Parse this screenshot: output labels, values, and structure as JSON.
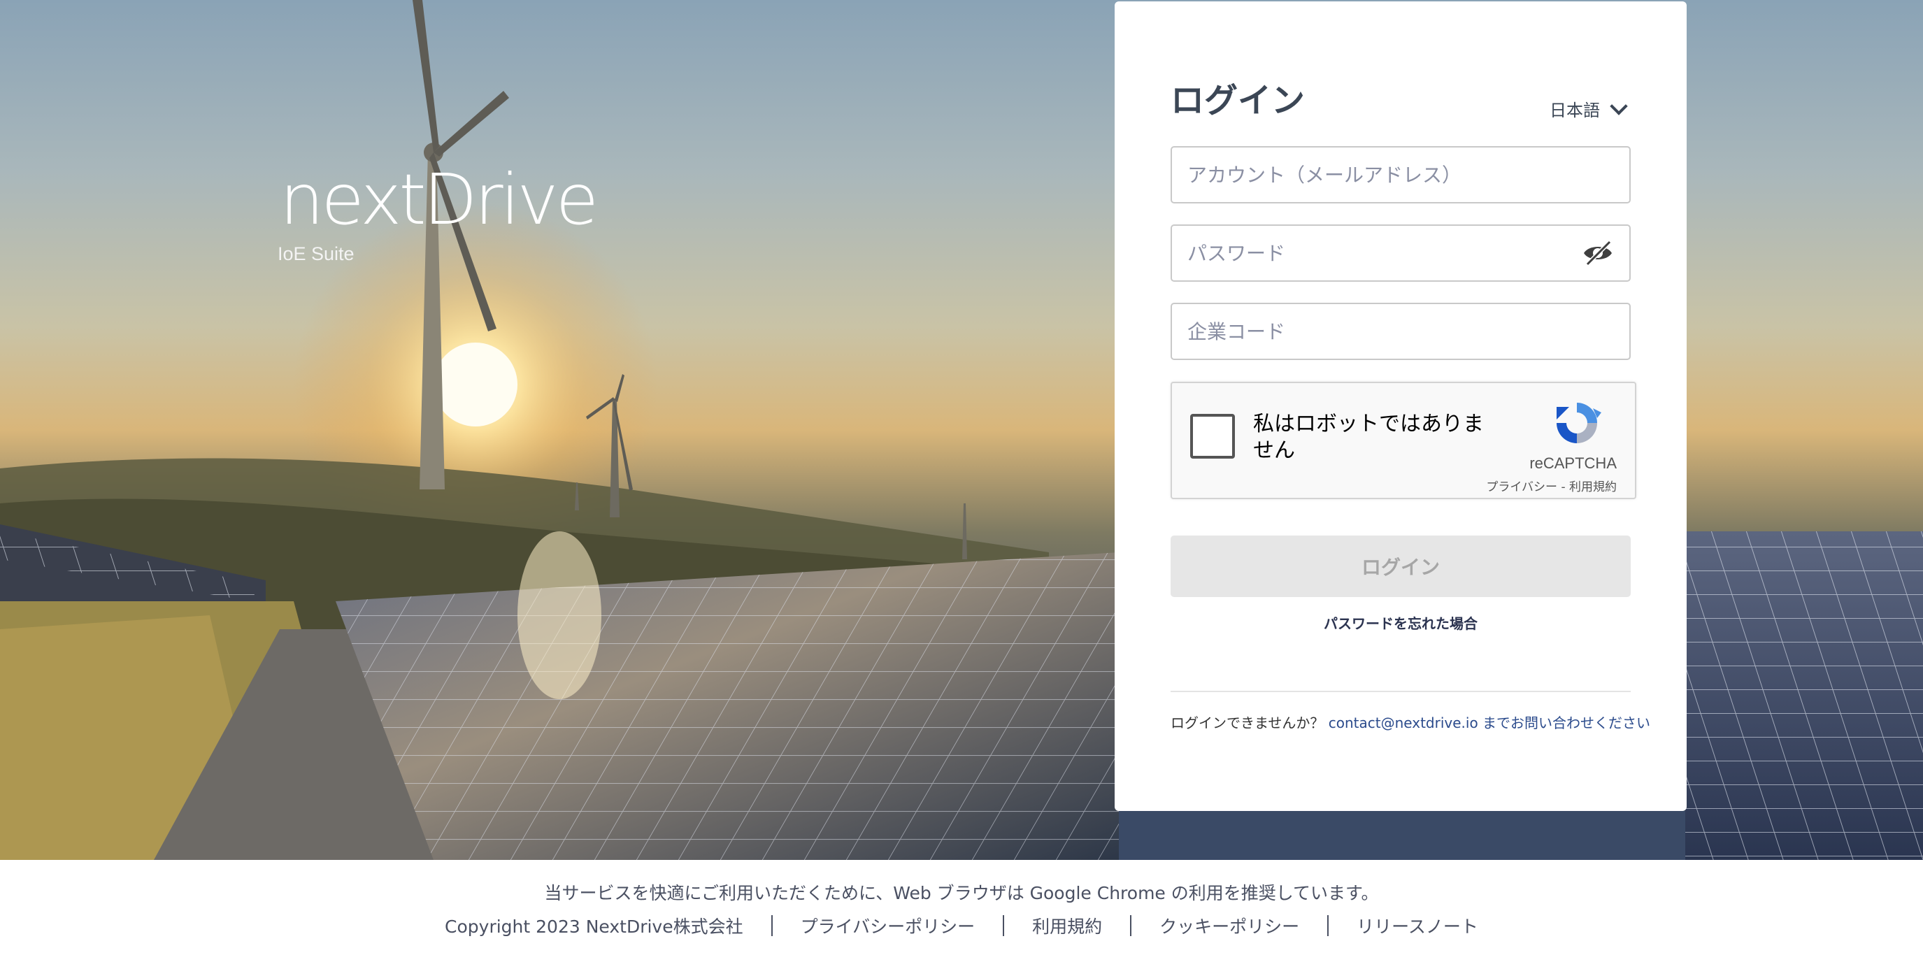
{
  "brand": {
    "logo_word": "nextDrive",
    "logo_sub": "IoE Suite"
  },
  "login": {
    "title": "ログイン",
    "language": "日本語",
    "account_placeholder": "アカウント（メールアドレス）",
    "password_placeholder": "パスワード",
    "company_placeholder": "企業コード",
    "recaptcha": {
      "label": "私はロボットではありません",
      "brand": "reCAPTCHA",
      "terms": "プライバシー - 利用規約"
    },
    "submit_label": "ログイン",
    "forgot_password": "パスワードを忘れた場合",
    "help": {
      "prefix": "ログインできませんか？",
      "email": "contact@nextdrive.io",
      "suffix": "までお問い合わせください"
    }
  },
  "footer": {
    "browser_note": "当サービスを快適にご利用いただくために、Web ブラウザは Google Chrome の利用を推奨しています。",
    "links": [
      "Copyright 2023 NextDrive株式会社",
      "プライバシーポリシー",
      "利用規約",
      "クッキーポリシー",
      "リリースノート"
    ]
  },
  "colors": {
    "title": "#3b4655",
    "button_disabled_bg": "#e6e6e6",
    "button_disabled_text": "#a6a6a6",
    "link": "#2b4b8c",
    "footer_text": "#4a5062"
  },
  "icons": [
    "eye-off-icon",
    "chevron-down-icon",
    "recaptcha-logo-icon"
  ]
}
